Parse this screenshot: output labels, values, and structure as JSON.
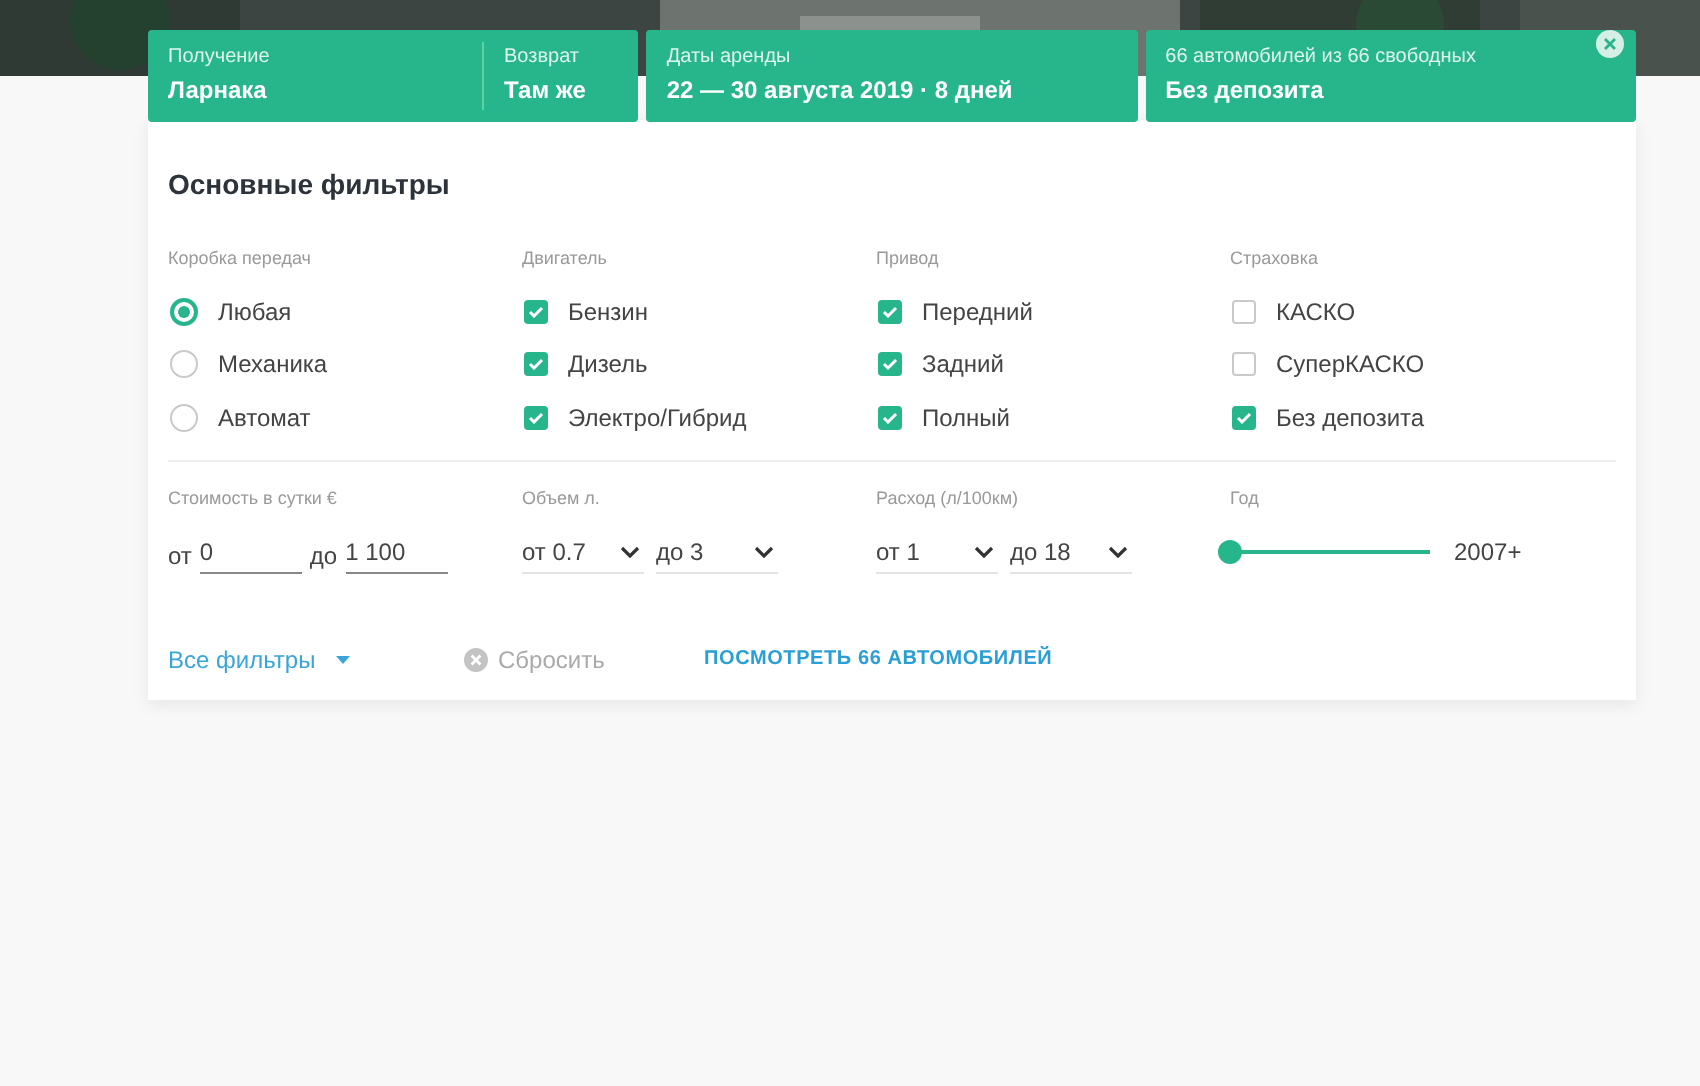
{
  "search_cards": [
    {
      "kind": "split",
      "parts": [
        {
          "label": "Получение",
          "value": "Ларнака"
        },
        {
          "label": "Возврат",
          "value": "Там же"
        }
      ]
    },
    {
      "kind": "single",
      "parts": [
        {
          "label": "Даты аренды",
          "value": "22 — 30 августа 2019 · 8 дней"
        }
      ]
    },
    {
      "kind": "clearable",
      "parts": [
        {
          "label": "66 автомобилей из 66 свободных",
          "value": "Без депозита"
        }
      ]
    }
  ],
  "filters": {
    "title": "Основные фильтры",
    "groups": [
      {
        "title": "Коробка передач",
        "kind": "radio",
        "options": [
          {
            "label": "Любая",
            "selected": true
          },
          {
            "label": "Механика",
            "selected": false
          },
          {
            "label": "Автомат",
            "selected": false
          }
        ]
      },
      {
        "title": "Двигатель",
        "kind": "checkbox",
        "options": [
          {
            "label": "Бензин",
            "checked": true
          },
          {
            "label": "Дизель",
            "checked": true
          },
          {
            "label": "Электро/Гибрид",
            "checked": true
          }
        ]
      },
      {
        "title": "Привод",
        "kind": "checkbox",
        "options": [
          {
            "label": "Передний",
            "checked": true
          },
          {
            "label": "Задний",
            "checked": true
          },
          {
            "label": "Полный",
            "checked": true
          }
        ]
      },
      {
        "title": "Страховка",
        "kind": "checkbox",
        "options": [
          {
            "label": "КАСКО",
            "checked": false
          },
          {
            "label": "СуперКАСКО",
            "checked": false
          },
          {
            "label": "Без депозита",
            "checked": true
          }
        ]
      }
    ],
    "ranges": [
      {
        "title": "Стоимость в сутки €",
        "kind": "inputs",
        "fields": [
          {
            "prefix": "от",
            "value": "0"
          },
          {
            "prefix": "до",
            "value": "1 100"
          }
        ]
      },
      {
        "title": "Объем л.",
        "kind": "selects",
        "fields": [
          {
            "value": "от 0.7"
          },
          {
            "value": "до 3"
          }
        ]
      },
      {
        "title": "Расход (л/100км)",
        "kind": "selects",
        "fields": [
          {
            "value": "от 1"
          },
          {
            "value": "до 18"
          }
        ]
      },
      {
        "title": "Год",
        "kind": "slider",
        "level": 0,
        "reading": "2007+"
      }
    ],
    "all_filters": "Все фильтры",
    "reset": "Сбросить",
    "show": "ПОСМОТРЕТЬ 66 АВТОМОБИЛЕЙ"
  }
}
